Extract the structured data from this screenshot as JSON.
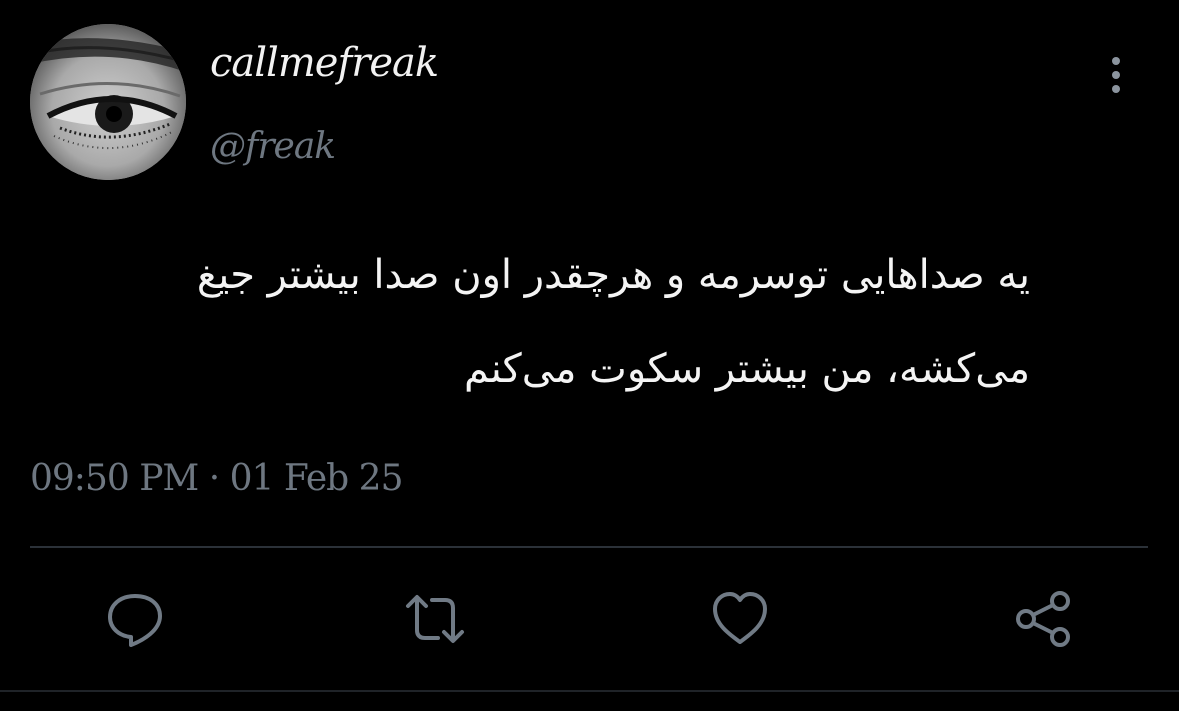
{
  "user": {
    "display_name": "callmefreak",
    "handle": "@freak",
    "avatar_icon": "eye-photo"
  },
  "tweet": {
    "text_line1": "یه صداهایی توسرمه و هرچقدر اون صدا بیشتر جیغ",
    "text_line2": "می‌کشه، من بیشتر سکوت می‌کنم",
    "timestamp": "09:50 PM · 01 Feb 25"
  },
  "actions": {
    "reply_icon": "reply-icon",
    "retweet_icon": "retweet-icon",
    "like_icon": "heart-icon",
    "share_icon": "share-icon",
    "more_icon": "more-vertical-icon"
  },
  "colors": {
    "background": "#000000",
    "text": "#f4f4f4",
    "muted": "#6e7781",
    "icon": "#707a85",
    "divider": "#2b3138"
  }
}
